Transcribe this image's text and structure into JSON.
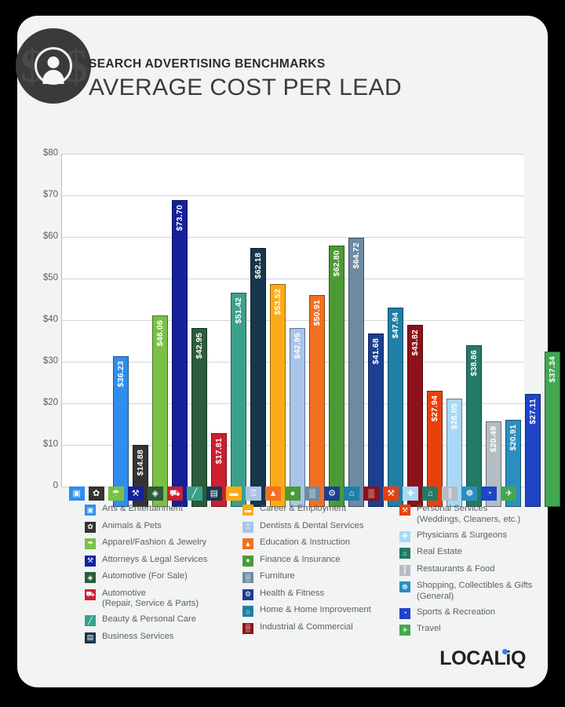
{
  "header": {
    "kicker": "SEARCH ADVERTISING BENCHMARKS",
    "title": "AVERAGE COST PER LEAD",
    "logo_icon": "person-dollar-logo"
  },
  "brand": {
    "text_before": "LOCAL",
    "text_i": "i",
    "text_after": "Q"
  },
  "chart_data": {
    "type": "bar",
    "title": "AVERAGE COST PER LEAD",
    "xlabel": "",
    "ylabel": "",
    "ylim": [
      0,
      80
    ],
    "grid": true,
    "legend_position": "bottom",
    "ytick_labels": [
      "$80",
      "$70",
      "$60",
      "$50",
      "$40",
      "$30",
      "$20",
      "$10",
      "0"
    ],
    "ytick_values": [
      80,
      70,
      60,
      50,
      40,
      30,
      20,
      10,
      0
    ],
    "categories": [
      "Arts & Entertainment",
      "Animals & Pets",
      "Apparel/Fashion & Jewelry",
      "Attorneys & Legal Services",
      "Automotive (For Sale)",
      "Automotive (Repair, Service & Parts)",
      "Beauty & Personal Care",
      "Business Services",
      "Career & Employment",
      "Dentists & Dental Services",
      "Education & Instruction",
      "Finance & Insurance",
      "Furniture",
      "Health & Fitness",
      "Home & Home Improvement",
      "Industrial & Commercial",
      "Personal Services (Weddings, Cleaners, etc.)",
      "Physicians & Surgeons",
      "Real Estate",
      "Restaurants & Food",
      "Shopping, Collectibles & Gifts (General)",
      "Sports & Recreation",
      "Travel"
    ],
    "values": [
      36.23,
      14.88,
      46.06,
      73.7,
      42.95,
      17.81,
      51.42,
      62.18,
      53.52,
      42.95,
      50.91,
      62.8,
      64.72,
      41.68,
      47.94,
      43.82,
      27.94,
      26.05,
      38.86,
      20.49,
      20.91,
      27.11,
      37.34
    ],
    "value_labels": [
      "$36.23",
      "$14.88",
      "$46.06",
      "$73.70",
      "$42.95",
      "$17.81",
      "$51.42",
      "$62.18",
      "$53.52",
      "$42.95",
      "$50.91",
      "$62.80",
      "$64.72",
      "$41.68",
      "$47.94",
      "$43.82",
      "$27.94",
      "$26.05",
      "$38.86",
      "$20.49",
      "$20.91",
      "$27.11",
      "$37.34"
    ],
    "colors": [
      "#2f8eed",
      "#333333",
      "#7ac143",
      "#14219b",
      "#2b5c3b",
      "#cc2031",
      "#3aa08c",
      "#17364d",
      "#fbab18",
      "#a8c4e8",
      "#f37021",
      "#4b9b35",
      "#6d8aa3",
      "#1b3f93",
      "#1f7fa6",
      "#8c1118",
      "#e8400d",
      "#a8d8f5",
      "#237a67",
      "#b4bdc4",
      "#2a8fc0",
      "#1f44c8",
      "#43a751"
    ],
    "icons": [
      "picture-icon",
      "paw-icon",
      "tshirt-icon",
      "gavel-icon",
      "car-tag-icon",
      "car-icon",
      "lipstick-icon",
      "document-icon",
      "briefcase-icon",
      "tooth-icon",
      "graduation-cap-icon",
      "piggy-bank-icon",
      "sofa-icon",
      "dumbbell-icon",
      "house-icon",
      "factory-icon",
      "wrench-person-icon",
      "medical-cross-icon",
      "storefront-icon",
      "fork-knife-icon",
      "gift-bow-icon",
      "ball-icon",
      "airplane-icon"
    ]
  },
  "legend": {
    "columns": [
      {
        "items": [
          {
            "label": "Arts & Entertainment",
            "color": "#2f8eed",
            "icon": "picture-icon",
            "glyph": "▣"
          },
          {
            "label": "Animals & Pets",
            "color": "#333333",
            "icon": "paw-icon",
            "glyph": "✿"
          },
          {
            "label": "Apparel/Fashion & Jewelry",
            "color": "#7ac143",
            "icon": "tshirt-icon",
            "glyph": "☂"
          },
          {
            "label": "Attorneys & Legal Services",
            "color": "#14219b",
            "icon": "gavel-icon",
            "glyph": "⚒"
          },
          {
            "label": "Automotive (For Sale)",
            "color": "#2b5c3b",
            "icon": "car-tag-icon",
            "glyph": "◈"
          },
          {
            "label": "Automotive\n(Repair, Service & Parts)",
            "color": "#cc2031",
            "icon": "car-icon",
            "glyph": "⛟"
          },
          {
            "label": "Beauty & Personal Care",
            "color": "#3aa08c",
            "icon": "lipstick-icon",
            "glyph": "╱"
          },
          {
            "label": "Business Services",
            "color": "#17364d",
            "icon": "document-icon",
            "glyph": "▤"
          }
        ]
      },
      {
        "items": [
          {
            "label": "Career & Employment",
            "color": "#fbab18",
            "icon": "briefcase-icon",
            "glyph": "▬"
          },
          {
            "label": "Dentists & Dental Services",
            "color": "#a8c4e8",
            "icon": "tooth-icon",
            "glyph": "♖"
          },
          {
            "label": "Education & Instruction",
            "color": "#f37021",
            "icon": "graduation-cap-icon",
            "glyph": "▲"
          },
          {
            "label": "Finance & Insurance",
            "color": "#4b9b35",
            "icon": "piggy-bank-icon",
            "glyph": "●"
          },
          {
            "label": "Furniture",
            "color": "#6d8aa3",
            "icon": "sofa-icon",
            "glyph": "▒"
          },
          {
            "label": "Health & Fitness",
            "color": "#1b3f93",
            "icon": "dumbbell-icon",
            "glyph": "⚙"
          },
          {
            "label": "Home & Home Improvement",
            "color": "#1f7fa6",
            "icon": "house-icon",
            "glyph": "⌂"
          },
          {
            "label": "Industrial & Commercial",
            "color": "#8c1118",
            "icon": "factory-icon",
            "glyph": "▒"
          }
        ]
      },
      {
        "items": [
          {
            "label": "Personal Services\n(Weddings, Cleaners, etc.)",
            "color": "#e8400d",
            "icon": "wrench-person-icon",
            "glyph": "⚒"
          },
          {
            "label": "Physicians & Surgeons",
            "color": "#a8d8f5",
            "icon": "medical-cross-icon",
            "glyph": "✚"
          },
          {
            "label": "Real Estate",
            "color": "#237a67",
            "icon": "storefront-icon",
            "glyph": "⌂"
          },
          {
            "label": "Restaurants & Food",
            "color": "#b4bdc4",
            "icon": "fork-knife-icon",
            "glyph": "║"
          },
          {
            "label": "Shopping, Collectibles & Gifts\n(General)",
            "color": "#2a8fc0",
            "icon": "gift-bow-icon",
            "glyph": "❁"
          },
          {
            "label": "Sports & Recreation",
            "color": "#1f44c8",
            "icon": "ball-icon",
            "glyph": "◔"
          },
          {
            "label": "Travel",
            "color": "#43a751",
            "icon": "airplane-icon",
            "glyph": "✈"
          }
        ]
      }
    ]
  }
}
